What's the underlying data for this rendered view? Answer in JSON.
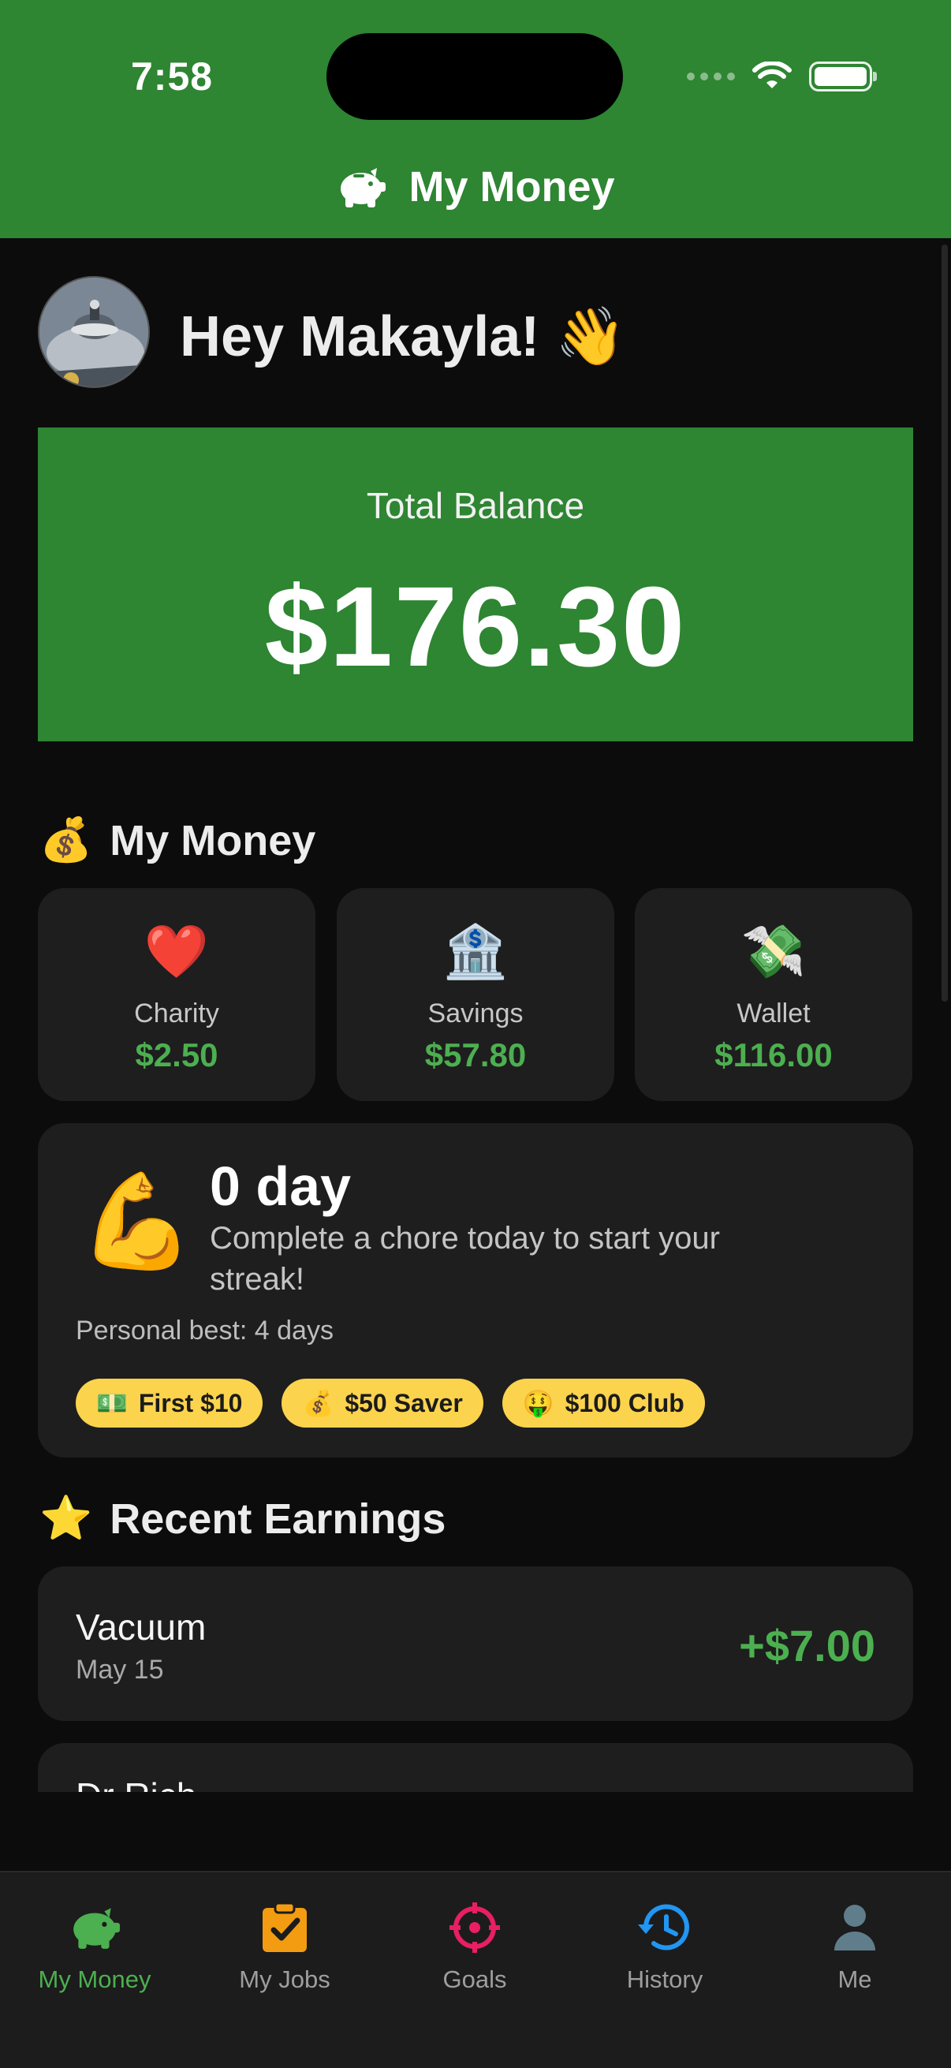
{
  "status_bar": {
    "time": "7:58"
  },
  "nav": {
    "title": "My Money"
  },
  "greeting": {
    "text": "Hey Makayla! 👋"
  },
  "balance": {
    "label": "Total Balance",
    "value": "$176.30"
  },
  "money_section": {
    "icon": "💰",
    "title": "My Money"
  },
  "accounts": [
    {
      "emoji": "❤️",
      "label": "Charity",
      "amount": "$2.50"
    },
    {
      "emoji": "🏦",
      "label": "Savings",
      "amount": "$57.80"
    },
    {
      "emoji": "💸",
      "label": "Wallet",
      "amount": "$116.00"
    }
  ],
  "streak": {
    "emoji": "💪",
    "days": "0 day",
    "message": "Complete a chore today to start your streak!",
    "personal_best": "Personal best: 4 days",
    "badges": [
      {
        "emoji": "💵",
        "label": "First $10"
      },
      {
        "emoji": "💰",
        "label": "$50 Saver"
      },
      {
        "emoji": "🤑",
        "label": "$100 Club"
      }
    ]
  },
  "earnings_section": {
    "icon": "⭐",
    "title": "Recent Earnings"
  },
  "earnings": [
    {
      "name": "Vacuum",
      "date": "May 15",
      "amount": "+$7.00"
    },
    {
      "name": "Dr Rich",
      "date": "",
      "amount": ""
    }
  ],
  "tabs": [
    {
      "label": "My Money",
      "icon": "piggy-bank-icon",
      "color": "#4caf50",
      "active": true
    },
    {
      "label": "My Jobs",
      "icon": "clipboard-check-icon",
      "color": "#f39c12",
      "active": false
    },
    {
      "label": "Goals",
      "icon": "target-icon",
      "color": "#e91e63",
      "active": false
    },
    {
      "label": "History",
      "icon": "history-icon",
      "color": "#2196f3",
      "active": false
    },
    {
      "label": "Me",
      "icon": "person-icon",
      "color": "#607d8b",
      "active": false
    }
  ],
  "colors": {
    "brand_green": "#2e8532",
    "money_green": "#4caf50",
    "badge_yellow": "#fcd34d",
    "card_bg": "#1e1e1e"
  }
}
